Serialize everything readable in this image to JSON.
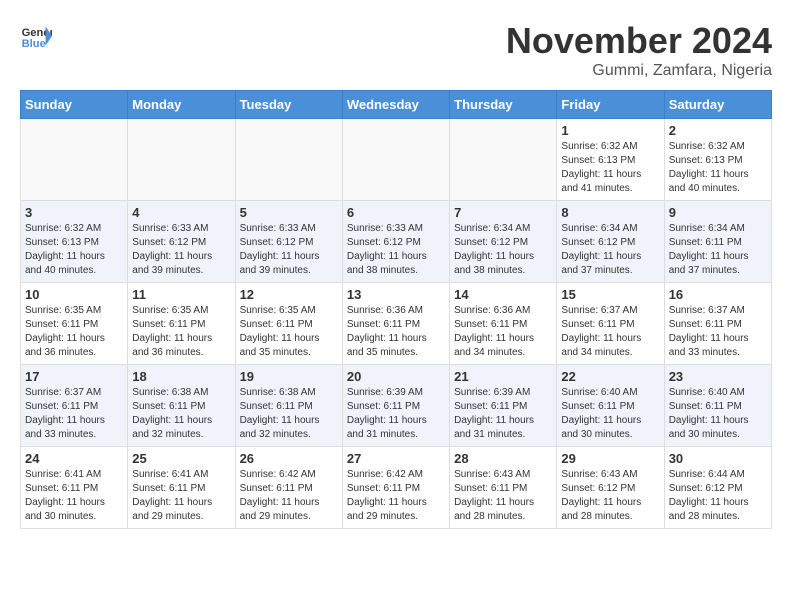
{
  "header": {
    "logo_line1": "General",
    "logo_line2": "Blue",
    "month": "November 2024",
    "location": "Gummi, Zamfara, Nigeria"
  },
  "weekdays": [
    "Sunday",
    "Monday",
    "Tuesday",
    "Wednesday",
    "Thursday",
    "Friday",
    "Saturday"
  ],
  "weeks": [
    [
      {
        "day": "",
        "info": ""
      },
      {
        "day": "",
        "info": ""
      },
      {
        "day": "",
        "info": ""
      },
      {
        "day": "",
        "info": ""
      },
      {
        "day": "",
        "info": ""
      },
      {
        "day": "1",
        "info": "Sunrise: 6:32 AM\nSunset: 6:13 PM\nDaylight: 11 hours\nand 41 minutes."
      },
      {
        "day": "2",
        "info": "Sunrise: 6:32 AM\nSunset: 6:13 PM\nDaylight: 11 hours\nand 40 minutes."
      }
    ],
    [
      {
        "day": "3",
        "info": "Sunrise: 6:32 AM\nSunset: 6:13 PM\nDaylight: 11 hours\nand 40 minutes."
      },
      {
        "day": "4",
        "info": "Sunrise: 6:33 AM\nSunset: 6:12 PM\nDaylight: 11 hours\nand 39 minutes."
      },
      {
        "day": "5",
        "info": "Sunrise: 6:33 AM\nSunset: 6:12 PM\nDaylight: 11 hours\nand 39 minutes."
      },
      {
        "day": "6",
        "info": "Sunrise: 6:33 AM\nSunset: 6:12 PM\nDaylight: 11 hours\nand 38 minutes."
      },
      {
        "day": "7",
        "info": "Sunrise: 6:34 AM\nSunset: 6:12 PM\nDaylight: 11 hours\nand 38 minutes."
      },
      {
        "day": "8",
        "info": "Sunrise: 6:34 AM\nSunset: 6:12 PM\nDaylight: 11 hours\nand 37 minutes."
      },
      {
        "day": "9",
        "info": "Sunrise: 6:34 AM\nSunset: 6:11 PM\nDaylight: 11 hours\nand 37 minutes."
      }
    ],
    [
      {
        "day": "10",
        "info": "Sunrise: 6:35 AM\nSunset: 6:11 PM\nDaylight: 11 hours\nand 36 minutes."
      },
      {
        "day": "11",
        "info": "Sunrise: 6:35 AM\nSunset: 6:11 PM\nDaylight: 11 hours\nand 36 minutes."
      },
      {
        "day": "12",
        "info": "Sunrise: 6:35 AM\nSunset: 6:11 PM\nDaylight: 11 hours\nand 35 minutes."
      },
      {
        "day": "13",
        "info": "Sunrise: 6:36 AM\nSunset: 6:11 PM\nDaylight: 11 hours\nand 35 minutes."
      },
      {
        "day": "14",
        "info": "Sunrise: 6:36 AM\nSunset: 6:11 PM\nDaylight: 11 hours\nand 34 minutes."
      },
      {
        "day": "15",
        "info": "Sunrise: 6:37 AM\nSunset: 6:11 PM\nDaylight: 11 hours\nand 34 minutes."
      },
      {
        "day": "16",
        "info": "Sunrise: 6:37 AM\nSunset: 6:11 PM\nDaylight: 11 hours\nand 33 minutes."
      }
    ],
    [
      {
        "day": "17",
        "info": "Sunrise: 6:37 AM\nSunset: 6:11 PM\nDaylight: 11 hours\nand 33 minutes."
      },
      {
        "day": "18",
        "info": "Sunrise: 6:38 AM\nSunset: 6:11 PM\nDaylight: 11 hours\nand 32 minutes."
      },
      {
        "day": "19",
        "info": "Sunrise: 6:38 AM\nSunset: 6:11 PM\nDaylight: 11 hours\nand 32 minutes."
      },
      {
        "day": "20",
        "info": "Sunrise: 6:39 AM\nSunset: 6:11 PM\nDaylight: 11 hours\nand 31 minutes."
      },
      {
        "day": "21",
        "info": "Sunrise: 6:39 AM\nSunset: 6:11 PM\nDaylight: 11 hours\nand 31 minutes."
      },
      {
        "day": "22",
        "info": "Sunrise: 6:40 AM\nSunset: 6:11 PM\nDaylight: 11 hours\nand 30 minutes."
      },
      {
        "day": "23",
        "info": "Sunrise: 6:40 AM\nSunset: 6:11 PM\nDaylight: 11 hours\nand 30 minutes."
      }
    ],
    [
      {
        "day": "24",
        "info": "Sunrise: 6:41 AM\nSunset: 6:11 PM\nDaylight: 11 hours\nand 30 minutes."
      },
      {
        "day": "25",
        "info": "Sunrise: 6:41 AM\nSunset: 6:11 PM\nDaylight: 11 hours\nand 29 minutes."
      },
      {
        "day": "26",
        "info": "Sunrise: 6:42 AM\nSunset: 6:11 PM\nDaylight: 11 hours\nand 29 minutes."
      },
      {
        "day": "27",
        "info": "Sunrise: 6:42 AM\nSunset: 6:11 PM\nDaylight: 11 hours\nand 29 minutes."
      },
      {
        "day": "28",
        "info": "Sunrise: 6:43 AM\nSunset: 6:11 PM\nDaylight: 11 hours\nand 28 minutes."
      },
      {
        "day": "29",
        "info": "Sunrise: 6:43 AM\nSunset: 6:12 PM\nDaylight: 11 hours\nand 28 minutes."
      },
      {
        "day": "30",
        "info": "Sunrise: 6:44 AM\nSunset: 6:12 PM\nDaylight: 11 hours\nand 28 minutes."
      }
    ]
  ]
}
